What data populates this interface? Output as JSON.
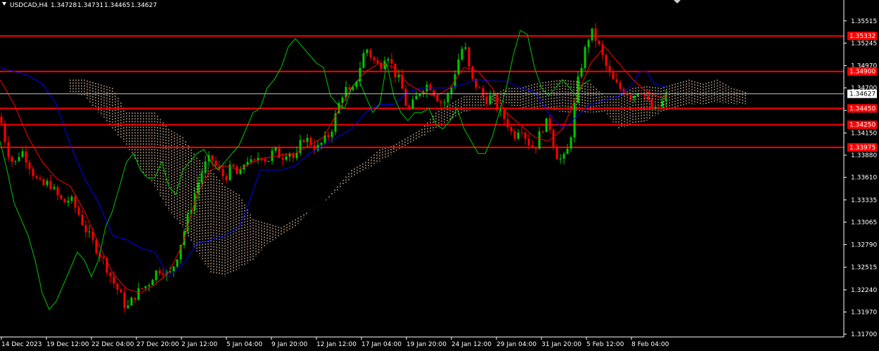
{
  "header": {
    "symbol": "USDCAD,H4",
    "ohlc": [
      "1.34728",
      "1.34731",
      "1.34465",
      "1.34627"
    ]
  },
  "chart_data": {
    "type": "candlestick",
    "ylim": [
      1.317,
      1.3565
    ],
    "y_ticks": [
      "1.35515",
      "1.35245",
      "1.34970",
      "1.34700",
      "1.34425",
      "1.34150",
      "1.33880",
      "1.33610",
      "1.33335",
      "1.33065",
      "1.32790",
      "1.32515",
      "1.32240",
      "1.31970",
      "1.31700"
    ],
    "x_ticks": [
      "14 Dec 2023",
      "19 Dec 12:00",
      "22 Dec 04:00",
      "27 Dec 20:00",
      "2 Jan 12:00",
      "5 Jan 04:00",
      "9 Jan 20:00",
      "12 Jan 12:00",
      "17 Jan 04:00",
      "19 Jan 20:00",
      "24 Jan 12:00",
      "29 Jan 04:00",
      "31 Jan 20:00",
      "5 Feb 12:00",
      "8 Feb 04:00"
    ],
    "horizontal_levels": [
      {
        "value": 1.35332,
        "label": "1.35332"
      },
      {
        "value": 1.349,
        "label": "1.34900"
      },
      {
        "value": 1.3445,
        "label": "1.34450"
      },
      {
        "value": 1.3425,
        "label": "1.34250"
      },
      {
        "value": 1.33975,
        "label": "1.33975"
      }
    ],
    "current_price": {
      "value": 1.34627,
      "label": "1.34627"
    },
    "colors": {
      "up": "#00c800",
      "down": "#ff0000",
      "level": "#ff0000",
      "kijun": "#0000ff",
      "tenkan": "#ff0000",
      "chikou": "#00c800",
      "cloud": "#ffdab9",
      "price_line": "#c0c0c0"
    },
    "path_points": [
      [
        0,
        1.3435
      ],
      [
        10,
        1.3395
      ],
      [
        20,
        1.3375
      ],
      [
        30,
        1.3395
      ],
      [
        40,
        1.338
      ],
      [
        50,
        1.336
      ],
      [
        60,
        1.335
      ],
      [
        70,
        1.3355
      ],
      [
        80,
        1.334
      ],
      [
        90,
        1.333
      ],
      [
        100,
        1.3335
      ],
      [
        110,
        1.332
      ],
      [
        120,
        1.33
      ],
      [
        130,
        1.3285
      ],
      [
        140,
        1.327
      ],
      [
        150,
        1.3255
      ],
      [
        160,
        1.3235
      ],
      [
        170,
        1.322
      ],
      [
        180,
        1.32
      ],
      [
        190,
        1.3215
      ],
      [
        200,
        1.3225
      ],
      [
        210,
        1.323
      ],
      [
        220,
        1.3245
      ],
      [
        230,
        1.325
      ],
      [
        240,
        1.324
      ],
      [
        250,
        1.326
      ],
      [
        260,
        1.329
      ],
      [
        270,
        1.332
      ],
      [
        280,
        1.335
      ],
      [
        290,
        1.3375
      ],
      [
        300,
        1.3385
      ],
      [
        310,
        1.337
      ],
      [
        320,
        1.336
      ],
      [
        330,
        1.3375
      ],
      [
        340,
        1.336
      ],
      [
        350,
        1.3385
      ],
      [
        360,
        1.3375
      ],
      [
        370,
        1.339
      ],
      [
        380,
        1.338
      ],
      [
        390,
        1.3395
      ],
      [
        400,
        1.3385
      ],
      [
        410,
        1.3395
      ],
      [
        420,
        1.338
      ],
      [
        430,
        1.341
      ],
      [
        440,
        1.3405
      ],
      [
        450,
        1.3395
      ],
      [
        460,
        1.3405
      ],
      [
        470,
        1.3415
      ],
      [
        480,
        1.3445
      ],
      [
        490,
        1.347
      ],
      [
        500,
        1.346
      ],
      [
        510,
        1.349
      ],
      [
        520,
        1.352
      ],
      [
        530,
        1.3505
      ],
      [
        540,
        1.3495
      ],
      [
        550,
        1.3515
      ],
      [
        560,
        1.349
      ],
      [
        570,
        1.3475
      ],
      [
        580,
        1.344
      ],
      [
        590,
        1.3455
      ],
      [
        600,
        1.347
      ],
      [
        610,
        1.3475
      ],
      [
        620,
        1.346
      ],
      [
        630,
        1.345
      ],
      [
        640,
        1.3465
      ],
      [
        650,
        1.35
      ],
      [
        660,
        1.3525
      ],
      [
        670,
        1.348
      ],
      [
        680,
        1.347
      ],
      [
        690,
        1.3455
      ],
      [
        700,
        1.346
      ],
      [
        710,
        1.344
      ],
      [
        720,
        1.343
      ],
      [
        730,
        1.341
      ],
      [
        740,
        1.3425
      ],
      [
        750,
        1.3405
      ],
      [
        760,
        1.3395
      ],
      [
        770,
        1.342
      ],
      [
        780,
        1.343
      ],
      [
        790,
        1.339
      ],
      [
        800,
        1.338
      ],
      [
        810,
        1.34
      ],
      [
        820,
        1.347
      ],
      [
        830,
        1.351
      ],
      [
        840,
        1.354
      ],
      [
        850,
        1.3525
      ],
      [
        860,
        1.35
      ],
      [
        870,
        1.348
      ],
      [
        880,
        1.347
      ],
      [
        890,
        1.3465
      ],
      [
        900,
        1.346
      ],
      [
        910,
        1.347
      ],
      [
        920,
        1.3455
      ],
      [
        930,
        1.344
      ],
      [
        940,
        1.345
      ],
      [
        950,
        1.3462
      ]
    ],
    "kijun_points": [
      [
        0,
        1.3495
      ],
      [
        20,
        1.349
      ],
      [
        40,
        1.3485
      ],
      [
        60,
        1.3475
      ],
      [
        80,
        1.345
      ],
      [
        100,
        1.34
      ],
      [
        120,
        1.336
      ],
      [
        140,
        1.333
      ],
      [
        160,
        1.329
      ],
      [
        180,
        1.3285
      ],
      [
        200,
        1.3275
      ],
      [
        220,
        1.327
      ],
      [
        240,
        1.324
      ],
      [
        260,
        1.3255
      ],
      [
        280,
        1.328
      ],
      [
        300,
        1.3285
      ],
      [
        320,
        1.329
      ],
      [
        340,
        1.33
      ],
      [
        350,
        1.332
      ],
      [
        370,
        1.337
      ],
      [
        400,
        1.337
      ],
      [
        420,
        1.3375
      ],
      [
        440,
        1.339
      ],
      [
        460,
        1.34
      ],
      [
        480,
        1.341
      ],
      [
        500,
        1.342
      ],
      [
        520,
        1.344
      ],
      [
        540,
        1.345
      ],
      [
        560,
        1.345
      ],
      [
        580,
        1.3465
      ],
      [
        600,
        1.347
      ],
      [
        640,
        1.347
      ],
      [
        660,
        1.3475
      ],
      [
        680,
        1.348
      ],
      [
        700,
        1.3478
      ],
      [
        720,
        1.3478
      ],
      [
        740,
        1.347
      ],
      [
        760,
        1.3465
      ],
      [
        780,
        1.344
      ],
      [
        800,
        1.342
      ],
      [
        820,
        1.3435
      ],
      [
        840,
        1.345
      ],
      [
        860,
        1.3455
      ],
      [
        880,
        1.346
      ],
      [
        900,
        1.3475
      ],
      [
        910,
        1.349
      ],
      [
        920,
        1.349
      ],
      [
        930,
        1.3475
      ],
      [
        950,
        1.347
      ]
    ],
    "tenkan_points": [
      [
        0,
        1.348
      ],
      [
        20,
        1.345
      ],
      [
        40,
        1.341
      ],
      [
        60,
        1.338
      ],
      [
        80,
        1.336
      ],
      [
        100,
        1.335
      ],
      [
        120,
        1.332
      ],
      [
        140,
        1.328
      ],
      [
        160,
        1.3245
      ],
      [
        180,
        1.3225
      ],
      [
        200,
        1.322
      ],
      [
        220,
        1.323
      ],
      [
        240,
        1.3245
      ],
      [
        260,
        1.328
      ],
      [
        280,
        1.334
      ],
      [
        300,
        1.337
      ],
      [
        320,
        1.3375
      ],
      [
        340,
        1.337
      ],
      [
        360,
        1.338
      ],
      [
        380,
        1.3385
      ],
      [
        400,
        1.3388
      ],
      [
        420,
        1.339
      ],
      [
        440,
        1.34
      ],
      [
        460,
        1.341
      ],
      [
        480,
        1.344
      ],
      [
        500,
        1.347
      ],
      [
        520,
        1.349
      ],
      [
        540,
        1.35
      ],
      [
        560,
        1.3495
      ],
      [
        580,
        1.3475
      ],
      [
        600,
        1.3465
      ],
      [
        620,
        1.346
      ],
      [
        640,
        1.347
      ],
      [
        660,
        1.3495
      ],
      [
        680,
        1.349
      ],
      [
        700,
        1.347
      ],
      [
        720,
        1.344
      ],
      [
        740,
        1.3425
      ],
      [
        760,
        1.341
      ],
      [
        780,
        1.3405
      ],
      [
        800,
        1.342
      ],
      [
        820,
        1.346
      ],
      [
        840,
        1.35
      ],
      [
        860,
        1.352
      ],
      [
        880,
        1.35
      ],
      [
        900,
        1.348
      ],
      [
        920,
        1.3465
      ],
      [
        940,
        1.3458
      ],
      [
        950,
        1.346
      ]
    ],
    "chikou_points": [
      [
        0,
        1.3405
      ],
      [
        10,
        1.337
      ],
      [
        20,
        1.333
      ],
      [
        30,
        1.331
      ],
      [
        40,
        1.329
      ],
      [
        50,
        1.326
      ],
      [
        60,
        1.322
      ],
      [
        70,
        1.32
      ],
      [
        80,
        1.321
      ],
      [
        90,
        1.323
      ],
      [
        100,
        1.325
      ],
      [
        110,
        1.327
      ],
      [
        120,
        1.326
      ],
      [
        130,
        1.324
      ],
      [
        140,
        1.326
      ],
      [
        150,
        1.33
      ],
      [
        160,
        1.332
      ],
      [
        170,
        1.335
      ],
      [
        180,
        1.338
      ],
      [
        190,
        1.339
      ],
      [
        200,
        1.337
      ],
      [
        210,
        1.336
      ],
      [
        220,
        1.336
      ],
      [
        230,
        1.338
      ],
      [
        240,
        1.335
      ],
      [
        250,
        1.334
      ],
      [
        260,
        1.337
      ],
      [
        270,
        1.338
      ],
      [
        280,
        1.339
      ],
      [
        290,
        1.3395
      ],
      [
        300,
        1.338
      ],
      [
        310,
        1.337
      ],
      [
        320,
        1.338
      ],
      [
        330,
        1.339
      ],
      [
        340,
        1.34
      ],
      [
        350,
        1.342
      ],
      [
        360,
        1.344
      ],
      [
        370,
        1.3445
      ],
      [
        380,
        1.347
      ],
      [
        390,
        1.348
      ],
      [
        400,
        1.3495
      ],
      [
        410,
        1.352
      ],
      [
        420,
        1.353
      ],
      [
        430,
        1.352
      ],
      [
        440,
        1.351
      ],
      [
        450,
        1.35
      ],
      [
        460,
        1.3495
      ],
      [
        470,
        1.346
      ],
      [
        480,
        1.345
      ],
      [
        490,
        1.3445
      ],
      [
        500,
        1.347
      ],
      [
        510,
        1.348
      ],
      [
        520,
        1.346
      ],
      [
        530,
        1.344
      ],
      [
        540,
        1.345
      ],
      [
        550,
        1.35
      ],
      [
        560,
        1.346
      ],
      [
        570,
        1.344
      ],
      [
        580,
        1.343
      ],
      [
        590,
        1.344
      ],
      [
        600,
        1.344
      ],
      [
        610,
        1.3445
      ],
      [
        620,
        1.3425
      ],
      [
        630,
        1.342
      ],
      [
        640,
        1.343
      ],
      [
        650,
        1.3445
      ],
      [
        660,
        1.342
      ],
      [
        670,
        1.3405
      ],
      [
        680,
        1.339
      ],
      [
        690,
        1.339
      ],
      [
        700,
        1.341
      ],
      [
        710,
        1.344
      ],
      [
        720,
        1.347
      ],
      [
        730,
        1.351
      ],
      [
        740,
        1.354
      ],
      [
        750,
        1.3535
      ],
      [
        760,
        1.3495
      ],
      [
        770,
        1.347
      ],
      [
        780,
        1.346
      ],
      [
        790,
        1.347
      ],
      [
        800,
        1.348
      ],
      [
        810,
        1.347
      ],
      [
        820,
        1.346
      ],
      [
        830,
        1.3475
      ],
      [
        840,
        1.348
      ]
    ],
    "cloud_upper": [
      [
        100,
        1.348
      ],
      [
        120,
        1.348
      ],
      [
        140,
        1.3475
      ],
      [
        160,
        1.347
      ],
      [
        180,
        1.344
      ],
      [
        200,
        1.344
      ],
      [
        220,
        1.344
      ],
      [
        240,
        1.342
      ],
      [
        260,
        1.341
      ],
      [
        280,
        1.3385
      ],
      [
        300,
        1.337
      ],
      [
        320,
        1.335
      ],
      [
        340,
        1.334
      ],
      [
        360,
        1.331
      ],
      [
        380,
        1.3305
      ],
      [
        400,
        1.33
      ],
      [
        420,
        1.331
      ],
      [
        440,
        1.332
      ],
      [
        460,
        1.333
      ],
      [
        480,
        1.335
      ],
      [
        500,
        1.337
      ],
      [
        520,
        1.338
      ],
      [
        540,
        1.3395
      ],
      [
        560,
        1.34
      ],
      [
        580,
        1.341
      ],
      [
        600,
        1.342
      ],
      [
        620,
        1.344
      ],
      [
        640,
        1.345
      ],
      [
        660,
        1.346
      ],
      [
        680,
        1.346
      ],
      [
        700,
        1.346
      ],
      [
        720,
        1.347
      ],
      [
        740,
        1.347
      ],
      [
        760,
        1.3475
      ],
      [
        780,
        1.3478
      ],
      [
        800,
        1.348
      ],
      [
        820,
        1.3478
      ],
      [
        840,
        1.3475
      ],
      [
        860,
        1.346
      ],
      [
        880,
        1.346
      ],
      [
        900,
        1.347
      ],
      [
        920,
        1.3472
      ],
      [
        940,
        1.347
      ],
      [
        960,
        1.3475
      ],
      [
        980,
        1.348
      ],
      [
        1000,
        1.3475
      ],
      [
        1020,
        1.348
      ],
      [
        1040,
        1.347
      ],
      [
        1060,
        1.3465
      ]
    ],
    "cloud_lower": [
      [
        100,
        1.3465
      ],
      [
        120,
        1.346
      ],
      [
        140,
        1.344
      ],
      [
        160,
        1.342
      ],
      [
        180,
        1.34
      ],
      [
        200,
        1.337
      ],
      [
        220,
        1.335
      ],
      [
        240,
        1.332
      ],
      [
        260,
        1.33
      ],
      [
        280,
        1.327
      ],
      [
        300,
        1.3245
      ],
      [
        320,
        1.324
      ],
      [
        340,
        1.325
      ],
      [
        360,
        1.326
      ],
      [
        380,
        1.328
      ],
      [
        400,
        1.329
      ],
      [
        420,
        1.33
      ],
      [
        440,
        1.332
      ],
      [
        460,
        1.333
      ],
      [
        480,
        1.3345
      ],
      [
        500,
        1.336
      ],
      [
        520,
        1.337
      ],
      [
        540,
        1.338
      ],
      [
        560,
        1.339
      ],
      [
        580,
        1.34
      ],
      [
        600,
        1.341
      ],
      [
        620,
        1.342
      ],
      [
        640,
        1.343
      ],
      [
        660,
        1.344
      ],
      [
        680,
        1.3445
      ],
      [
        700,
        1.345
      ],
      [
        720,
        1.345
      ],
      [
        740,
        1.3445
      ],
      [
        760,
        1.3445
      ],
      [
        780,
        1.3445
      ],
      [
        800,
        1.344
      ],
      [
        820,
        1.344
      ],
      [
        840,
        1.344
      ],
      [
        860,
        1.344
      ],
      [
        880,
        1.342
      ],
      [
        900,
        1.3425
      ],
      [
        920,
        1.343
      ],
      [
        940,
        1.344
      ],
      [
        960,
        1.3445
      ],
      [
        980,
        1.345
      ],
      [
        1000,
        1.345
      ],
      [
        1020,
        1.3452
      ],
      [
        1040,
        1.345
      ],
      [
        1060,
        1.345
      ]
    ],
    "candle_count": 190,
    "seed": 7
  }
}
